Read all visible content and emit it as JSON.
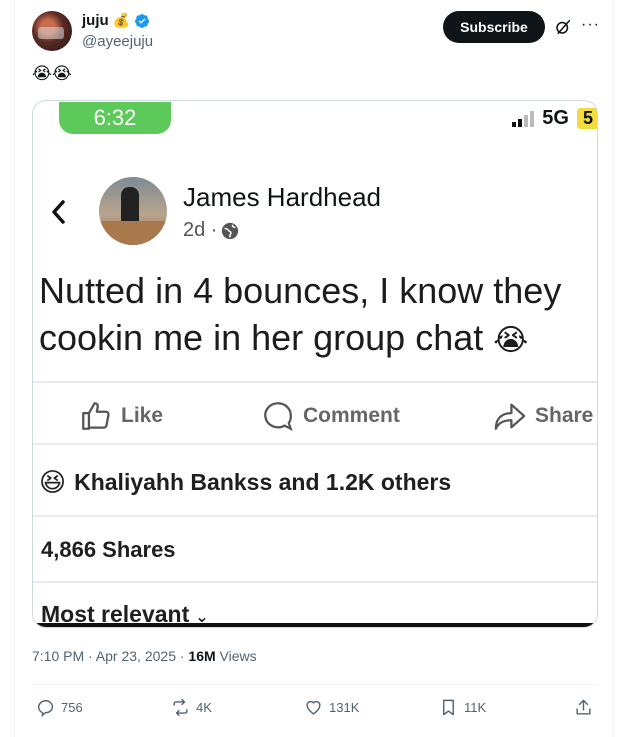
{
  "author": {
    "display_name": "juju",
    "name_emoji": "💰",
    "handle": "@ayeejuju",
    "verified_icon": "verified-badge-icon"
  },
  "header": {
    "subscribe_label": "Subscribe"
  },
  "tweet": {
    "text": "😭😭"
  },
  "screenshot": {
    "status_time": "6:32",
    "network": "5G",
    "battery": "5",
    "fb_author": "James Hardhead",
    "fb_age": "2d ·",
    "post_text": "Nutted in 4 bounces, I know they cookin me in her group chat",
    "post_emoji": "😭",
    "actions": {
      "like": "Like",
      "comment": "Comment",
      "share": "Share"
    },
    "reaction_emoji": "😆",
    "reactions_text": "Khaliyahh Bankss and 1.2K others",
    "shares_text": "4,866 Shares",
    "sort_label": "Most relevant",
    "colors": {
      "time_pill": "#5dc95a",
      "battery": "#f2dc3e"
    }
  },
  "meta": {
    "time_date": "7:10 PM · Apr 23, 2025 · ",
    "views_count": "16M",
    "views_label": " Views"
  },
  "engagement": {
    "replies": "756",
    "reposts": "4K",
    "likes": "131K",
    "bookmarks": "11K"
  },
  "colors": {
    "accent": "#1d9bf0",
    "text": "#0f1419",
    "muted": "#536471"
  }
}
